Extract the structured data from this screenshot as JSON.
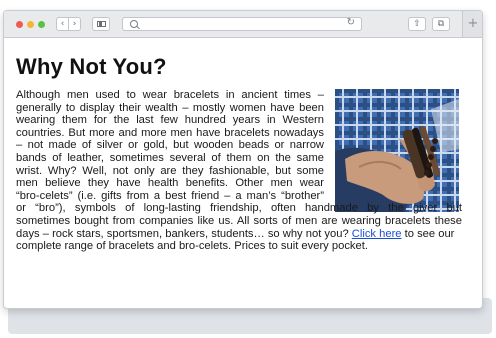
{
  "browser": {
    "toolbar": {
      "traffic_lights": {
        "close_color": "#f05a4f",
        "minimize_color": "#f5b730",
        "zoom_color": "#5ac144"
      },
      "back_icon": "‹",
      "forward_icon": "›",
      "reload_icon": "↻",
      "share_icon": "⇧",
      "tabs_icon": "⧉",
      "new_tab_icon": "+"
    },
    "address_bar": {
      "value": ""
    }
  },
  "article": {
    "title": "Why Not You?",
    "image": {
      "description_icon": "photo-man-bracelets-icon"
    },
    "lines": [
      "Although men used to wear bracelets in ancient times –",
      "generally to display their wealth – mostly women have been",
      "wearing them for the last few hundred years in Western",
      "countries. But more and more men have bracelets nowadays",
      "– not made of silver or gold, but wooden beads or narrow",
      "bands of leather, sometimes several of them on the same",
      "wrist. Why? Well, not only are they fashionable, but some",
      "men believe they have health benefits. Other men wear",
      "“bro-celets” (i.e. gifts from a best friend – a man’s “brother”",
      "or “bro”), symbols of long-lasting friendship, often  handmade by the giver but",
      "sometimes bought from companies like us. All sorts of men are wearing bracelets these"
    ],
    "line_last_before_link": "days – rock stars, sportsmen, bankers, students… so why not you?",
    "link_text": "Click here",
    "line_last_after_link": "to see our",
    "final_line": "complete range of bracelets and bro-celets. Prices to suit every pocket."
  },
  "colors": {
    "link": "#1a4fd6",
    "toolbar_bg": "#e9eaec",
    "text": "#1a1a1a"
  }
}
